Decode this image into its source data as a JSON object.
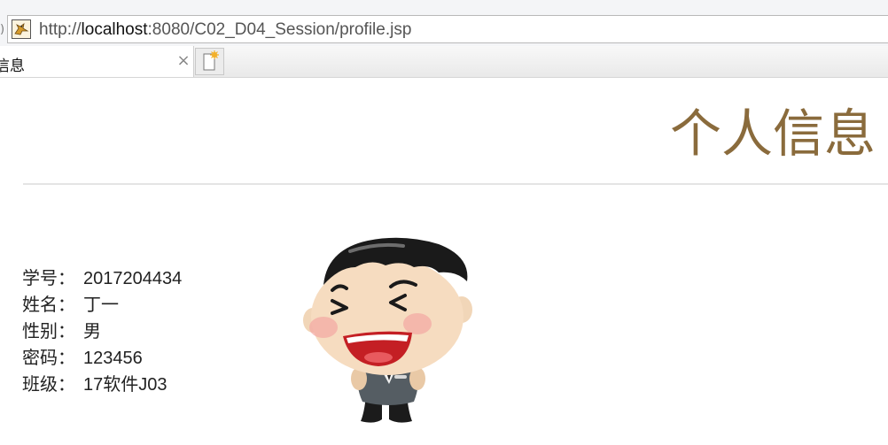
{
  "browser": {
    "url_prefix": "http://",
    "url_host": "localhost",
    "url_rest": ":8080/C02_D04_Session/profile.jsp",
    "left_edge_glyph": ")",
    "tab_title": "信息",
    "tab_close": "×"
  },
  "page": {
    "title": "个人信息",
    "fields": [
      {
        "label": "学号：",
        "value": "2017204434"
      },
      {
        "label": "姓名：",
        "value": "丁一"
      },
      {
        "label": "性别：",
        "value": "男"
      },
      {
        "label": "密码：",
        "value": "123456"
      },
      {
        "label": "班级：",
        "value": "17软件J03"
      }
    ]
  },
  "colors": {
    "title": "#8a6b3c",
    "text": "#222222",
    "divider": "#e4e4e4"
  },
  "icons": {
    "favicon": "tomcat-icon",
    "new_tab": "new-tab-icon",
    "avatar": "cartoon-boy-avatar"
  }
}
